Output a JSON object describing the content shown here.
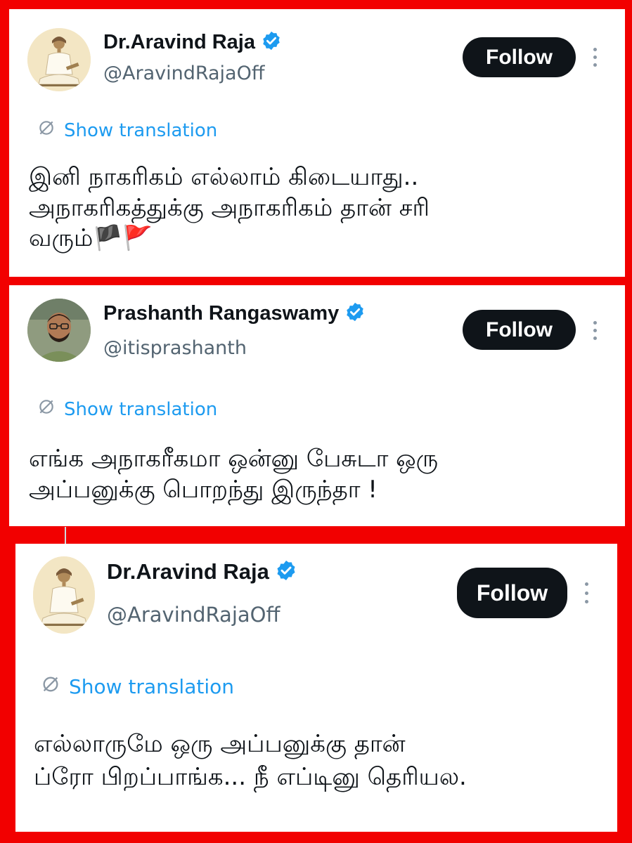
{
  "posts": [
    {
      "name": "Dr.Aravind Raja",
      "handle": "@AravindRajaOff",
      "follow_label": "Follow",
      "translate_label": "Show translation",
      "lines": [
        "இனி நாகரிகம் எல்லாம் கிடையாது..",
        "அநாகரிகத்துக்கு அநாகரிகம் தான் சரி",
        "வரும்🏴🚩"
      ],
      "avatar_icon": "saint-portrait"
    },
    {
      "name": "Prashanth Rangaswamy",
      "handle": "@itisprashanth",
      "follow_label": "Follow",
      "translate_label": "Show translation",
      "lines": [
        "எங்க அநாகரீகமா ஒன்னு பேசுடா ஒரு",
        "அப்பனுக்கு பொறந்து இருந்தா !"
      ],
      "avatar_icon": "man-with-glasses"
    },
    {
      "name": "Dr.Aravind Raja",
      "handle": "@AravindRajaOff",
      "follow_label": "Follow",
      "translate_label": "Show translation",
      "lines": [
        "எல்லாருமே ஒரு அப்பனுக்கு தான்",
        "ப்ரோ பிறப்பாங்க... நீ எப்டினு தெரியல."
      ],
      "avatar_icon": "saint-portrait"
    }
  ],
  "colors": {
    "frame": "#f20000",
    "follow_bg": "#0f1419",
    "verified": "#1d9bf0",
    "link": "#1d9bf0",
    "handle": "#536471"
  }
}
